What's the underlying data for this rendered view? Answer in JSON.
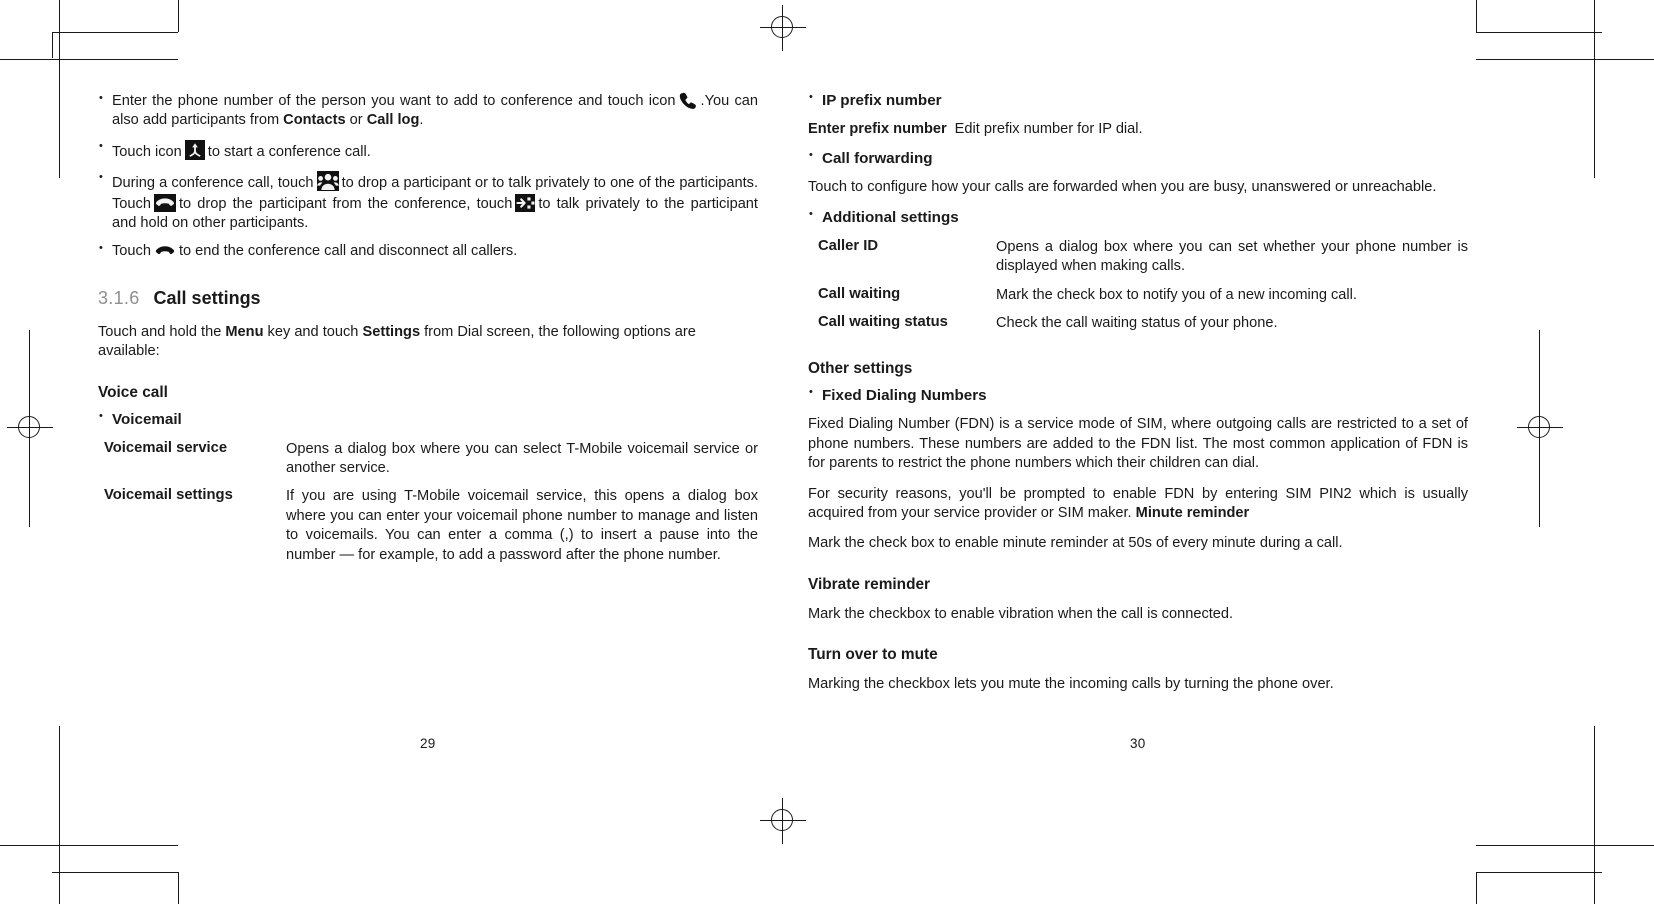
{
  "spread": {
    "left_page_number": "29",
    "right_page_number": "30"
  },
  "left_page": {
    "bullets": [
      {
        "before": "Enter the phone number of the person you want to add to conference and touch icon",
        "icon": "phone-handset-icon",
        "after_pre": ".You can also add participants from ",
        "bold_a": "Contacts",
        "mid": " or ",
        "bold_b": "Call log",
        "after_post": "."
      },
      {
        "before": "Touch icon",
        "icon": "merge-call-icon",
        "after_pre": "to start a conference call."
      },
      {
        "before": "During a conference call, touch",
        "icon": "conference-participants-icon",
        "after_pre": "to drop a participant or to talk privately to one of the participants. Touch",
        "icon2": "end-call-icon",
        "after_mid": "to drop the participant from the conference, touch",
        "icon3": "private-call-icon",
        "after_post": "to talk privately to the participant and hold on other participants."
      },
      {
        "before": "Touch",
        "icon": "end-call-icon",
        "after_pre": "to end the conference call and disconnect all callers."
      }
    ],
    "section": {
      "number": "3.1.6",
      "title": "Call settings"
    },
    "intro": {
      "t1": "Touch and hold the ",
      "b1": "Menu",
      "t2": " key and touch ",
      "b2": "Settings",
      "t3": " from Dial screen, the following options are available:"
    },
    "voice_call_heading": "Voice call",
    "voicemail_bullet": "Voicemail",
    "voicemail_table": [
      {
        "term": "Voicemail service",
        "desc": "Opens a dialog box where you can select T-Mobile voicemail service or another service."
      },
      {
        "term": "Voicemail settings",
        "desc": "If you are using T-Mobile voicemail service, this opens a dialog box where you can enter your voicemail phone number to manage and listen to voicemails. You can enter a comma (,) to insert a pause into the number — for example, to add a password after the phone number."
      }
    ]
  },
  "right_page": {
    "ip_prefix_bullet": "IP prefix number",
    "enter_prefix": {
      "term": "Enter prefix number",
      "desc": "Edit prefix number for IP dial."
    },
    "call_forwarding_bullet": "Call forwarding",
    "call_forwarding_desc": "Touch to configure how your calls are forwarded when you are busy, unanswered or unreachable.",
    "additional_settings_bullet": "Additional settings",
    "additional_table": [
      {
        "term": "Caller ID",
        "desc": "Opens a dialog box where you can set whether your phone number is displayed when making calls."
      },
      {
        "term": "Call waiting",
        "desc": "Mark the check box to notify you of a new incoming call."
      },
      {
        "term": "Call waiting status",
        "desc": "Check the call waiting status of your phone."
      }
    ],
    "other_settings_heading": "Other settings",
    "fdn_bullet": "Fixed Dialing Numbers",
    "fdn_para1": "Fixed Dialing Number (FDN) is a service mode of SIM, where outgoing calls are restricted to a set of phone numbers. These numbers are added to the FDN list. The most common application of FDN is for parents to restrict the phone numbers which their children can dial.",
    "fdn_para2": {
      "t1": "For security reasons, you'll be prompted to enable FDN by entering SIM PIN2 which is usually acquired from your service provider or SIM maker. ",
      "b1": "Minute reminder"
    },
    "minute_reminder_desc": "Mark the check box to enable minute reminder at 50s of every minute during a call.",
    "vibrate_heading": "Vibrate reminder",
    "vibrate_desc": "Mark the checkbox to enable vibration when the call is connected.",
    "turnover_heading": "Turn over to mute",
    "turnover_desc": "Marking the checkbox lets you mute the incoming calls by turning the phone over."
  }
}
